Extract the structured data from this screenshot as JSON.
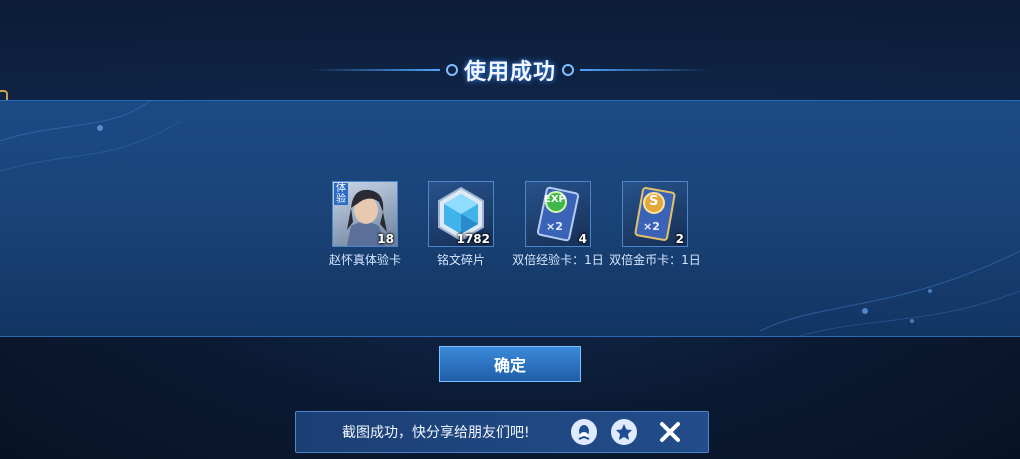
{
  "dialog": {
    "title": "使用成功",
    "items": [
      {
        "name": "赵怀真体验卡",
        "qty": "18",
        "badge": "体验",
        "icon": "hero-portrait-icon"
      },
      {
        "name": "铭文碎片",
        "qty": "1782",
        "icon": "inscription-crystal-icon"
      },
      {
        "name": "双倍经验卡：1日",
        "qty": "4",
        "badge": "EXP",
        "multiplier": "×2",
        "icon": "double-exp-card-icon"
      },
      {
        "name": "双倍金币卡：1日",
        "qty": "2",
        "badge": "S",
        "multiplier": "×2",
        "icon": "double-gold-card-icon"
      }
    ],
    "confirm_label": "确定"
  },
  "toast": {
    "text": "截图成功，快分享给朋友们吧!",
    "share_qq_icon": "qq-penguin-icon",
    "share_qzone_icon": "qzone-star-icon",
    "close_icon": "close-icon"
  },
  "colors": {
    "panel": "#1a4478",
    "accent": "#4ea3ff",
    "button": "#2a72c0",
    "gold": "#c8a24a"
  }
}
